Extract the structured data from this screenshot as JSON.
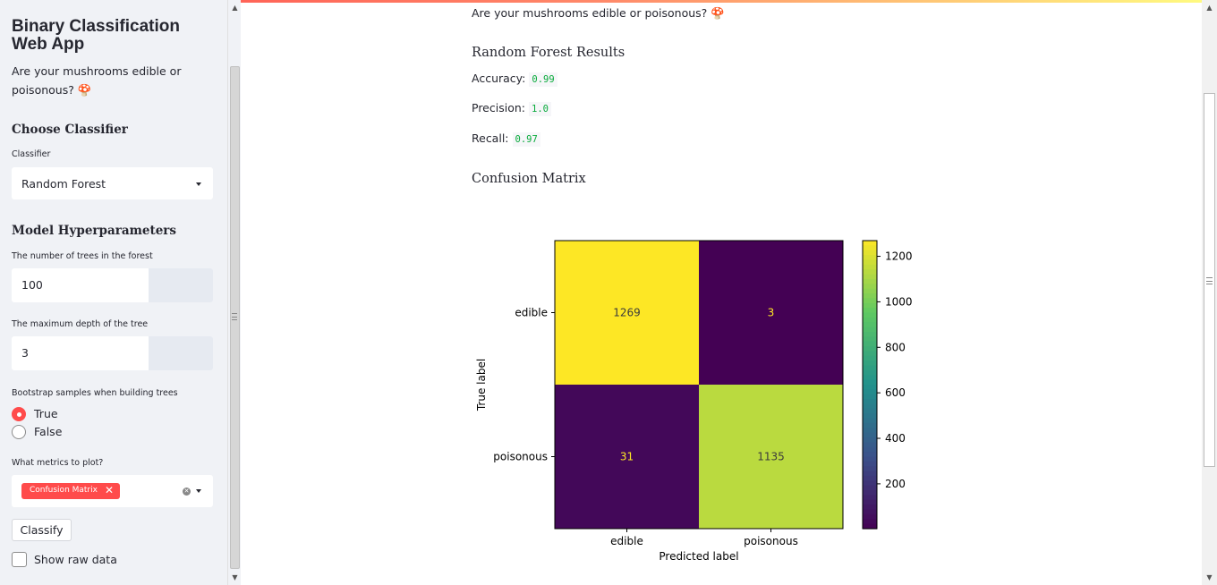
{
  "sidebar": {
    "title": "Binary Classification Web App",
    "subtitle": "Are your mushrooms edible or poisonous? 🍄",
    "choose_classifier_heading": "Choose Classifier",
    "classifier_label": "Classifier",
    "classifier_value": "Random Forest",
    "hyperparameters_heading": "Model Hyperparameters",
    "n_trees_label": "The number of trees in the forest",
    "n_trees_value": "100",
    "max_depth_label": "The maximum depth of the tree",
    "max_depth_value": "3",
    "bootstrap_label": "Bootstrap samples when building trees",
    "bootstrap_options": [
      "True",
      "False"
    ],
    "bootstrap_selected": "True",
    "metrics_label": "What metrics to plot?",
    "metrics_selected": [
      "Confusion Matrix"
    ],
    "classify_button": "Classify",
    "raw_data_checkbox": "Show raw data",
    "icons": [
      "caret-down-icon",
      "close-icon",
      "clear-icon",
      "chevron-down-icon"
    ]
  },
  "main": {
    "subtitle": "Are your mushrooms edible or poisonous? 🍄",
    "results_heading": "Random Forest Results",
    "accuracy_label": "Accuracy:",
    "accuracy_value": "0.99",
    "precision_label": "Precision:",
    "precision_value": "1.0",
    "recall_label": "Recall:",
    "recall_value": "0.97",
    "confusion_heading": "Confusion Matrix"
  },
  "colors": {
    "accent": "#ff4b4b",
    "metric_code": "#09ab3b",
    "sidebar_bg": "#f0f2f6"
  },
  "chart_data": {
    "type": "heatmap",
    "title": "",
    "xlabel": "Predicted label",
    "ylabel": "True label",
    "x_categories": [
      "edible",
      "poisonous"
    ],
    "y_categories": [
      "edible",
      "poisonous"
    ],
    "values": [
      [
        1269,
        3
      ],
      [
        31,
        1135
      ]
    ],
    "colorbar_ticks": [
      200,
      400,
      600,
      800,
      1000,
      1200
    ],
    "colorbar_range": [
      3,
      1269
    ],
    "colormap": "viridis"
  }
}
